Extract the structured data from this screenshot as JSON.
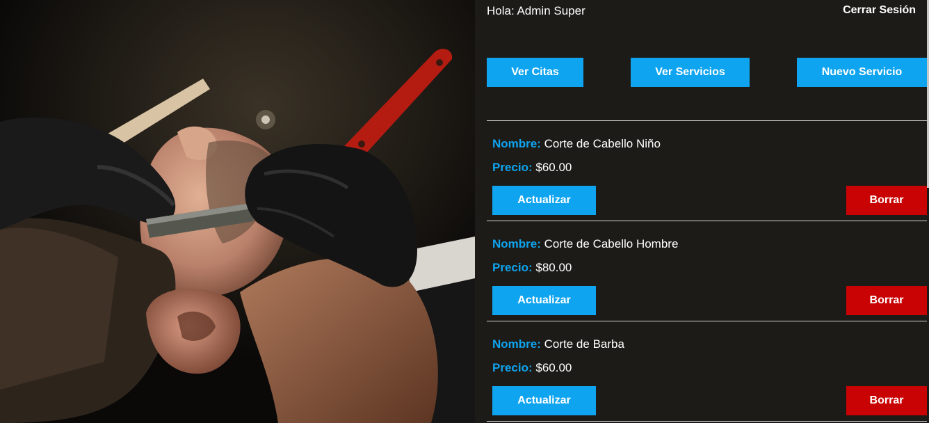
{
  "header": {
    "greeting": "Hola: Admin Super",
    "logout_label": "Cerrar Sesión"
  },
  "nav": {
    "buttons": [
      {
        "label": "Ver Citas"
      },
      {
        "label": "Ver Servicios"
      },
      {
        "label": "Nuevo Servicio"
      }
    ]
  },
  "services": {
    "name_key": "Nombre:",
    "price_key": "Precio:",
    "update_label": "Actualizar",
    "delete_label": "Borrar",
    "items": [
      {
        "name": "Corte de Cabello Niño",
        "price": "$60.00"
      },
      {
        "name": "Corte de Cabello Hombre",
        "price": "$80.00"
      },
      {
        "name": "Corte de Barba",
        "price": "$60.00"
      }
    ]
  },
  "colors": {
    "accent": "#0fa4ef",
    "danger": "#c90303",
    "panel_bg": "#1c1b17"
  },
  "hero": {
    "image": "barber-shaving-photo"
  }
}
